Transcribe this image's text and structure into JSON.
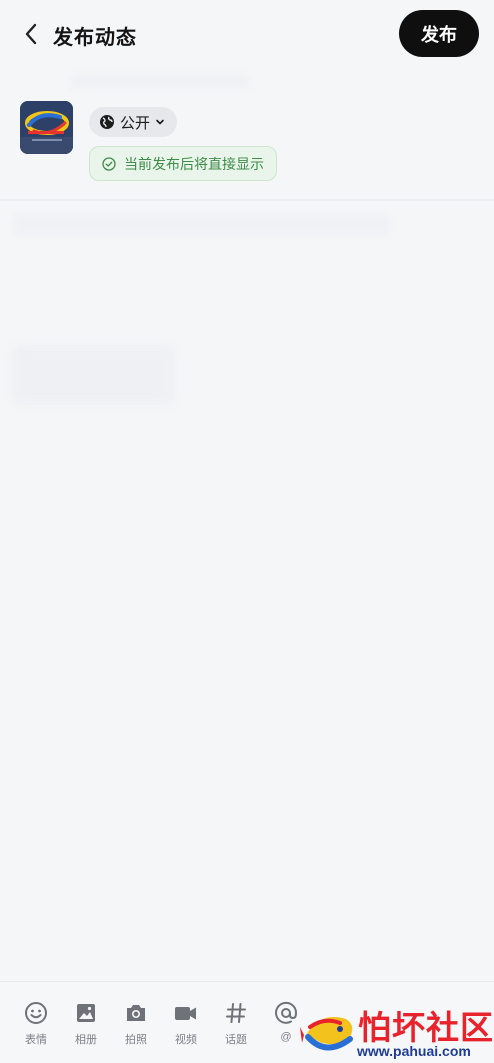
{
  "header": {
    "title": "发布动态",
    "publish_label": "发布"
  },
  "visibility": {
    "label": "公开"
  },
  "notice": {
    "text": "当前发布后将直接显示"
  },
  "toolbar": {
    "items": [
      {
        "label": "表情",
        "icon": "smile-icon"
      },
      {
        "label": "相册",
        "icon": "image-icon"
      },
      {
        "label": "拍照",
        "icon": "camera-icon"
      },
      {
        "label": "视频",
        "icon": "video-icon"
      },
      {
        "label": "话题",
        "icon": "hashtag-icon"
      },
      {
        "label": "@",
        "icon": "at-icon"
      }
    ]
  },
  "watermark": {
    "title": "怕坏社区",
    "url": "www.pahuai.com"
  },
  "colors": {
    "publish_button": "#0f0f0f",
    "notice_text": "#3e8c47",
    "background": "#f5f6f8"
  }
}
